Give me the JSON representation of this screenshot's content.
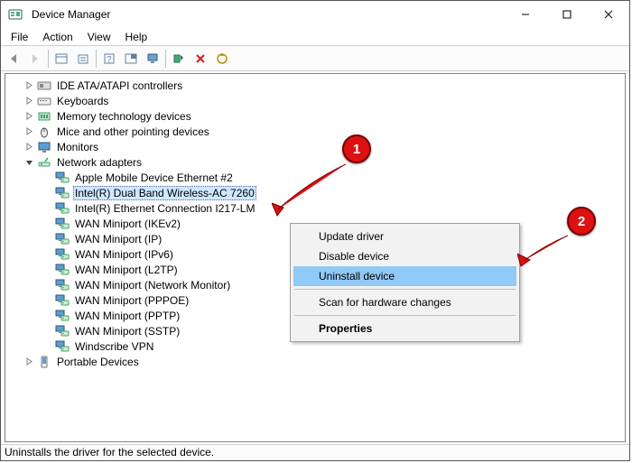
{
  "window": {
    "title": "Device Manager"
  },
  "menu": {
    "items": [
      "File",
      "Action",
      "View",
      "Help"
    ]
  },
  "status": "Uninstalls the driver for the selected device.",
  "categories": [
    {
      "label": "IDE ATA/ATAPI controllers",
      "icon": "ide"
    },
    {
      "label": "Keyboards",
      "icon": "keyboard"
    },
    {
      "label": "Memory technology devices",
      "icon": "memory"
    },
    {
      "label": "Mice and other pointing devices",
      "icon": "mouse"
    },
    {
      "label": "Monitors",
      "icon": "monitor"
    },
    {
      "label": "Network adapters",
      "icon": "network",
      "expanded": true
    },
    {
      "label": "Portable Devices",
      "icon": "portable"
    }
  ],
  "network_children": [
    "Apple Mobile Device Ethernet #2",
    "Intel(R) Dual Band Wireless-AC 7260",
    "Intel(R) Ethernet Connection I217-LM",
    "WAN Miniport (IKEv2)",
    "WAN Miniport (IP)",
    "WAN Miniport (IPv6)",
    "WAN Miniport (L2TP)",
    "WAN Miniport (Network Monitor)",
    "WAN Miniport (PPPOE)",
    "WAN Miniport (PPTP)",
    "WAN Miniport (SSTP)",
    "Windscribe VPN"
  ],
  "selected_child_index": 1,
  "context_menu": {
    "items": [
      {
        "label": "Update driver"
      },
      {
        "label": "Disable device"
      },
      {
        "label": "Uninstall device",
        "highlight": true
      },
      {
        "sep": true
      },
      {
        "label": "Scan for hardware changes"
      },
      {
        "sep": true
      },
      {
        "label": "Properties",
        "bold": true
      }
    ]
  },
  "annotations": {
    "badge1": "1",
    "badge2": "2"
  },
  "colors": {
    "accent": "#91c9f7",
    "selection": "#cde8ff",
    "badge": "#d11"
  }
}
